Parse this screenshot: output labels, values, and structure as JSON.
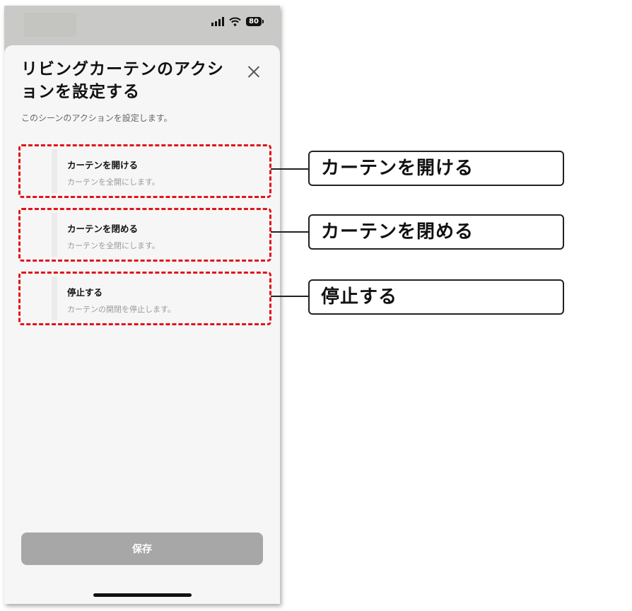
{
  "status_bar": {
    "battery_level": "80",
    "icons": [
      "signal-icon",
      "wifi-icon",
      "battery-icon"
    ]
  },
  "sheet": {
    "title": "リビングカーテンのアクションを設定する",
    "subtitle": "このシーンのアクションを設定します。",
    "actions": [
      {
        "name": "カーテンを開ける",
        "description": "カーテンを全開にします。"
      },
      {
        "name": "カーテンを閉める",
        "description": "カーテンを全閉にします。"
      },
      {
        "name": "停止する",
        "description": "カーテンの開閉を停止します。"
      }
    ],
    "save_label": "保存"
  },
  "callouts": [
    "カーテンを開ける",
    "カーテンを閉める",
    "停止する"
  ],
  "colors": {
    "highlight_dash": "#e0141b",
    "save_button": "#a7a7a7",
    "sheet_background": "#f6f6f6"
  }
}
